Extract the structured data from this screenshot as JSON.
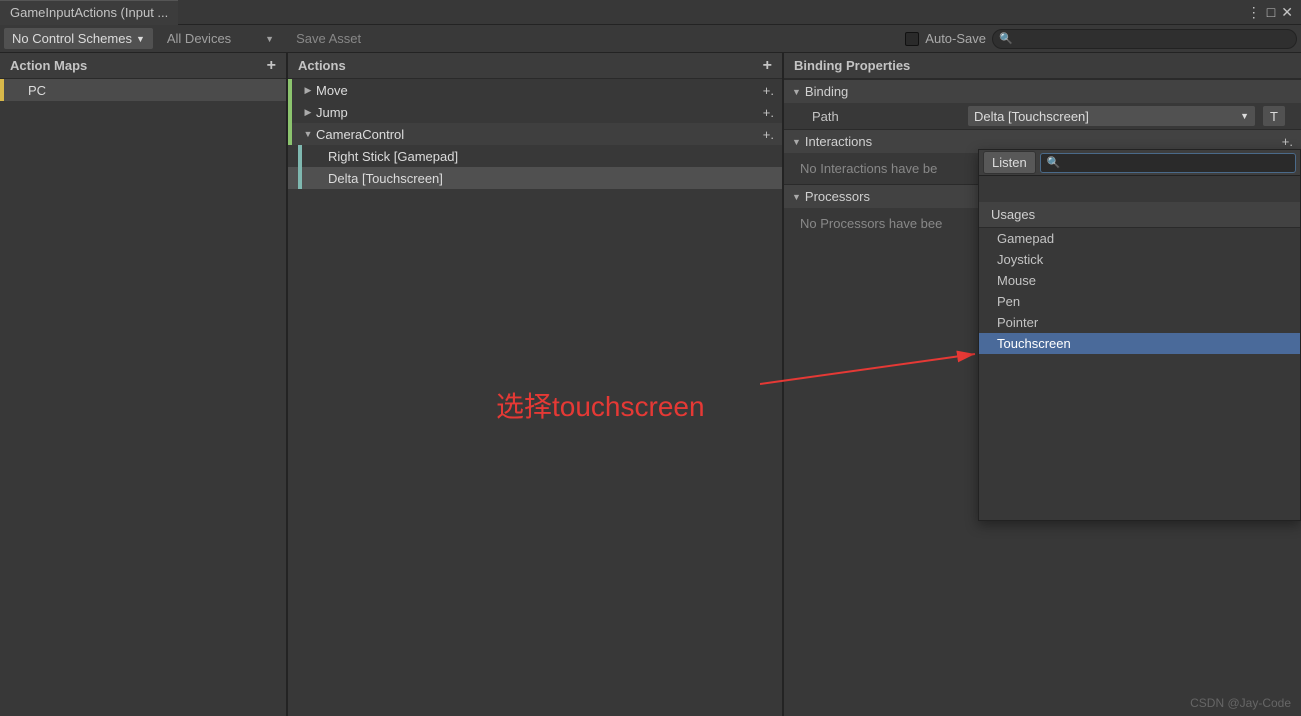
{
  "window": {
    "title": "GameInputActions (Input ..."
  },
  "toolbar": {
    "schemes": "No Control Schemes",
    "devices": "All Devices",
    "save": "Save Asset",
    "autoSave": "Auto-Save"
  },
  "columns": {
    "maps": {
      "header": "Action Maps",
      "items": [
        "PC"
      ]
    },
    "actions": {
      "header": "Actions",
      "tree": [
        {
          "name": "Move",
          "expanded": false
        },
        {
          "name": "Jump",
          "expanded": false
        },
        {
          "name": "CameraControl",
          "expanded": true,
          "bindings": [
            "Right Stick [Gamepad]",
            "Delta [Touchscreen]"
          ]
        }
      ]
    },
    "props": {
      "header": "Binding Properties",
      "binding": "Binding",
      "pathLabel": "Path",
      "pathValue": "Delta [Touchscreen]",
      "tBtn": "T",
      "interactions": "Interactions",
      "interactionsEmpty": "No Interactions have be",
      "processors": "Processors",
      "processorsEmpty": "No Processors have bee"
    }
  },
  "popup": {
    "listen": "Listen",
    "section": "Usages",
    "items": [
      "Gamepad",
      "Joystick",
      "Mouse",
      "Pen",
      "Pointer",
      "Touchscreen"
    ],
    "highlight": 5
  },
  "annotation": "选择touchscreen",
  "watermark": "CSDN @Jay-Code"
}
